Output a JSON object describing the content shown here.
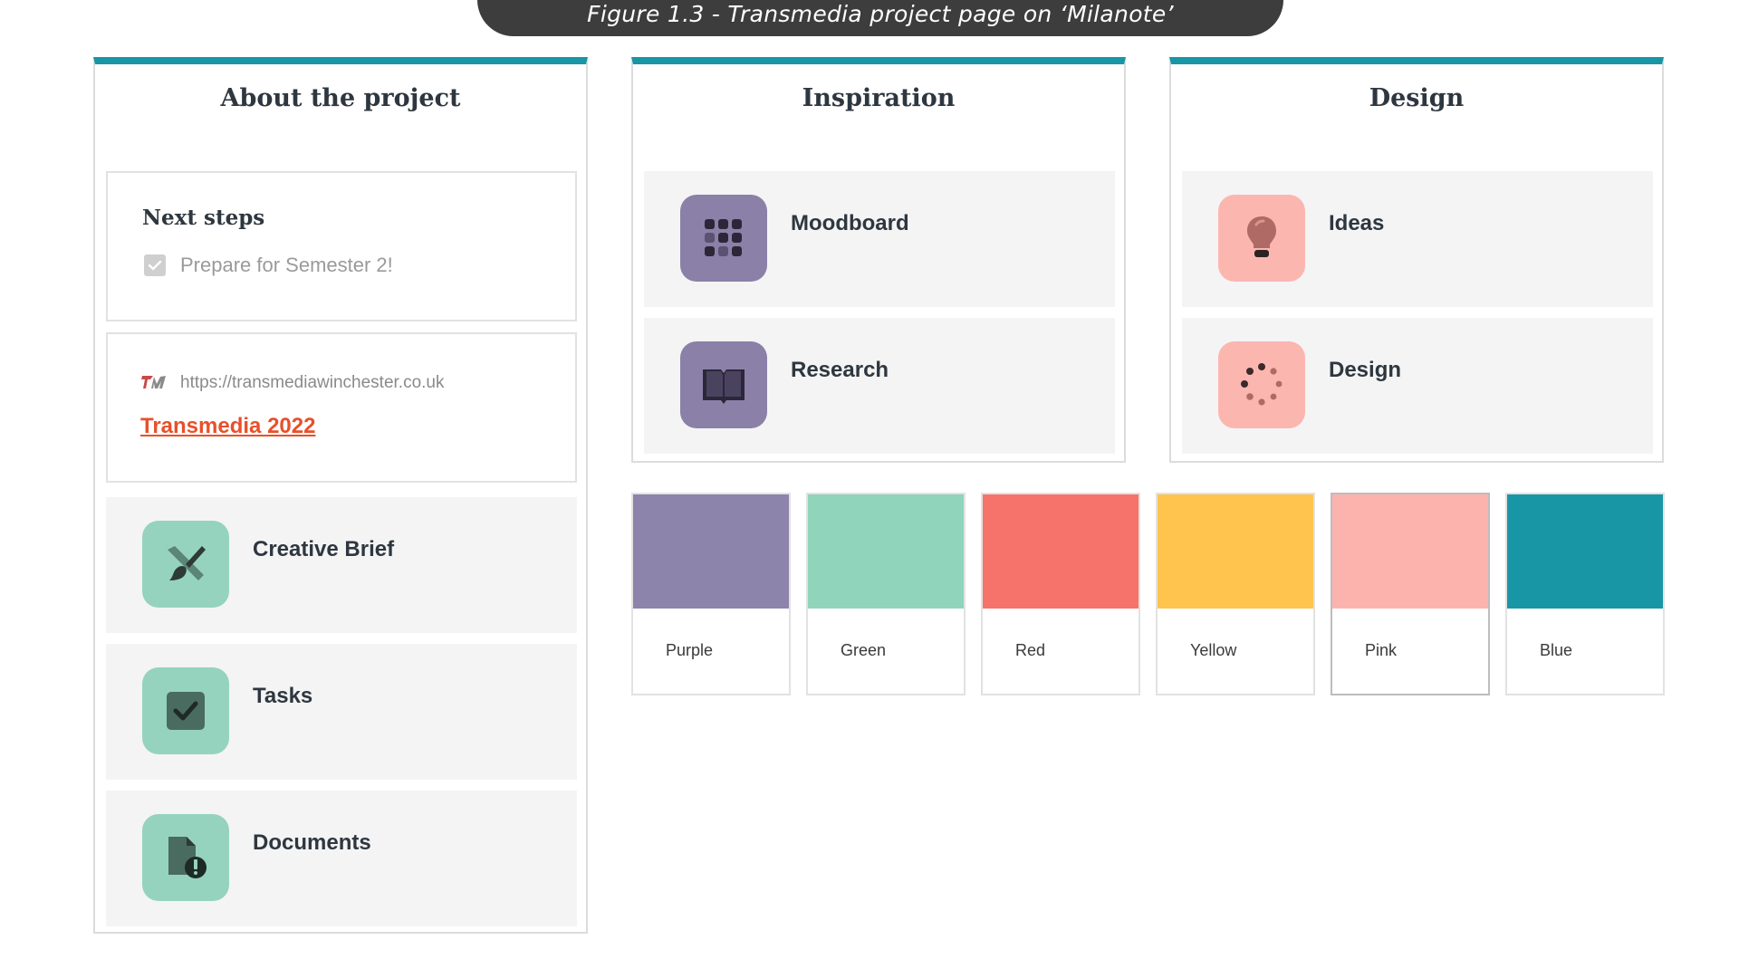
{
  "caption": "Figure 1.3 - Transmedia project page on ‘Milanote’",
  "columns": {
    "about": {
      "title": "About the project",
      "next_steps": {
        "title": "Next steps",
        "task": "Prepare for Semester 2!"
      },
      "link": {
        "url": "https://transmediawinchester.co.uk",
        "title": "Transmedia 2022"
      },
      "boards": [
        {
          "label": "Creative Brief",
          "icon": "paintbrush-icon"
        },
        {
          "label": "Tasks",
          "icon": "checkbox-icon"
        },
        {
          "label": "Documents",
          "icon": "document-alert-icon"
        }
      ]
    },
    "inspiration": {
      "title": "Inspiration",
      "boards": [
        {
          "label": "Moodboard",
          "icon": "grid-dots-icon"
        },
        {
          "label": "Research",
          "icon": "open-book-icon"
        }
      ]
    },
    "design": {
      "title": "Design",
      "boards": [
        {
          "label": "Ideas",
          "icon": "lightbulb-icon"
        },
        {
          "label": "Design",
          "icon": "spinner-dots-icon"
        }
      ]
    }
  },
  "swatches": [
    {
      "name": "Purple",
      "color": "#8d84ab"
    },
    {
      "name": "Green",
      "color": "#8fd4bb"
    },
    {
      "name": "Red",
      "color": "#f6736b"
    },
    {
      "name": "Yellow",
      "color": "#fec44d"
    },
    {
      "name": "Pink",
      "color": "#fdb3ad"
    },
    {
      "name": "Blue",
      "color": "#1996a6"
    }
  ],
  "colors": {
    "accent_bar": "#1996a6",
    "tile_green": "#95d3be",
    "tile_purple": "#8b80a8",
    "tile_pink": "#fcb6b0",
    "link": "#e8502a"
  }
}
